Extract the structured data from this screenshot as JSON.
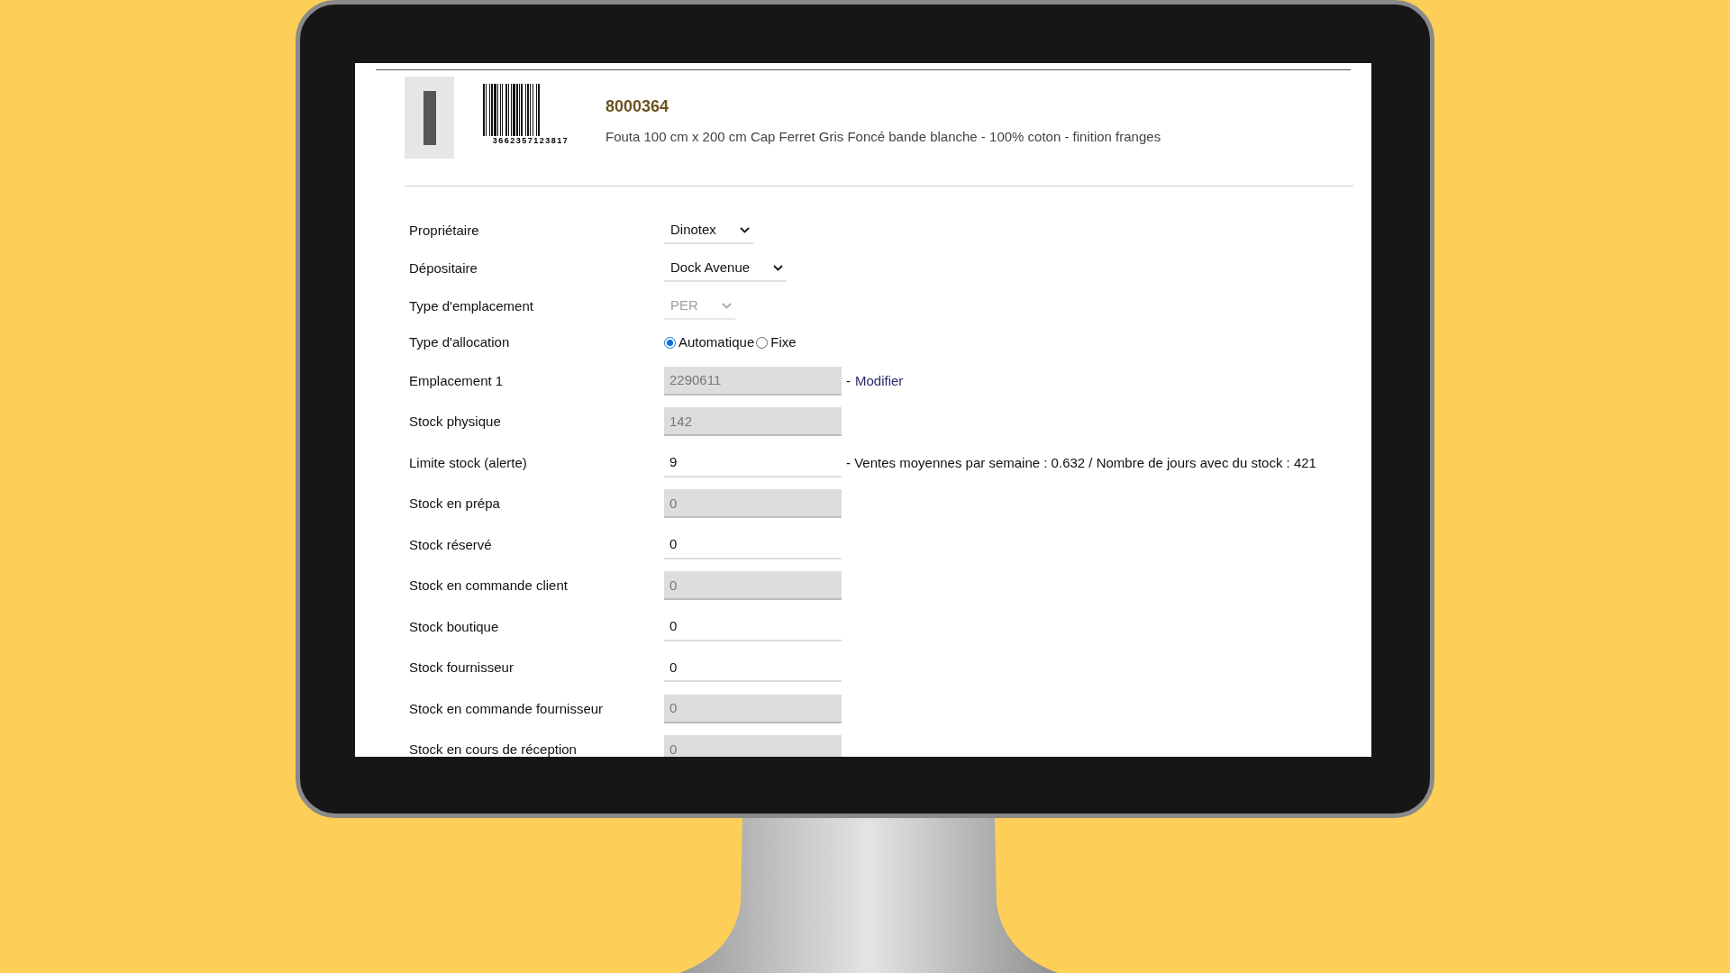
{
  "product": {
    "code": "8000364",
    "description": "Fouta 100 cm x 200 cm Cap Ferret Gris Foncé bande blanche - 100% coton - finition franges",
    "barcode_digits": "3662357123817"
  },
  "fields": [
    {
      "label": "Propriétaire",
      "kind": "select",
      "value": "Dinotex",
      "disabled": false
    },
    {
      "label": "Dépositaire",
      "kind": "select",
      "value": "Dock Avenue",
      "disabled": false
    },
    {
      "label": "Type d'emplacement",
      "kind": "select",
      "value": "PER",
      "disabled": true
    },
    {
      "label": "Type d'allocation",
      "kind": "radio",
      "options": [
        {
          "label": "Automatique",
          "selected": true
        },
        {
          "label": "Fixe",
          "selected": false
        }
      ]
    },
    {
      "label": "Emplacement 1",
      "kind": "input",
      "value": "2290611",
      "readonly": true,
      "separator": "-",
      "link": "Modifier"
    },
    {
      "label": "Stock physique",
      "kind": "input",
      "value": "142",
      "readonly": true
    },
    {
      "label": "Limite stock (alerte)",
      "kind": "input",
      "value": "9",
      "readonly": false,
      "note": "- Ventes moyennes par semaine : 0.632 / Nombre de jours avec du stock : 421"
    },
    {
      "label": "Stock en prépa",
      "kind": "input",
      "value": "0",
      "readonly": true
    },
    {
      "label": "Stock réservé",
      "kind": "input",
      "value": "0",
      "readonly": false
    },
    {
      "label": "Stock en commande client",
      "kind": "input",
      "value": "0",
      "readonly": true
    },
    {
      "label": "Stock boutique",
      "kind": "input",
      "value": "0",
      "readonly": false
    },
    {
      "label": "Stock fournisseur",
      "kind": "input",
      "value": "0",
      "readonly": false
    },
    {
      "label": "Stock en commande fournisseur",
      "kind": "input",
      "value": "0",
      "readonly": true
    },
    {
      "label": "Stock en cours de réception",
      "kind": "input",
      "value": "0",
      "readonly": true
    }
  ]
}
